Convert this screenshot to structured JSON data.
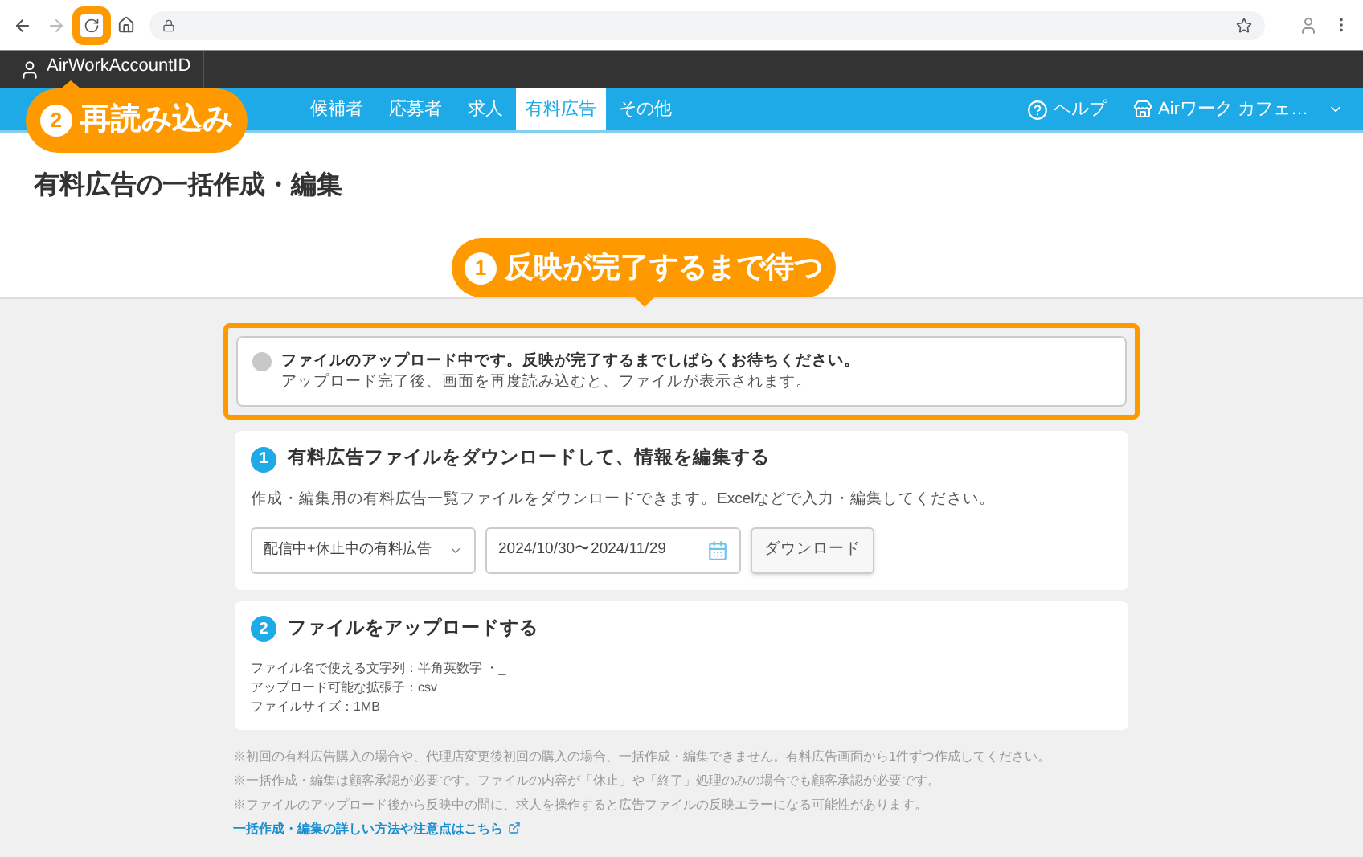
{
  "account": {
    "label": "AirWorkAccountID"
  },
  "nav": {
    "tabs": [
      {
        "label": "候補者",
        "selected": false
      },
      {
        "label": "応募者",
        "selected": false
      },
      {
        "label": "求人",
        "selected": false
      },
      {
        "label": "有料広告",
        "selected": true
      },
      {
        "label": "その他",
        "selected": false
      }
    ],
    "help": "ヘルプ",
    "store": "Airワーク カフェ…"
  },
  "page": {
    "title": "有料広告の一括作成・編集"
  },
  "alert": {
    "title": "ファイルのアップロード中です。反映が完了するまでしばらくお待ちください。",
    "body": "アップロード完了後、画面を再度読み込むと、ファイルが表示されます。"
  },
  "step1": {
    "number": "1",
    "title": "有料広告ファイルをダウンロードして、情報を編集する",
    "description": "作成・編集用の有料広告一覧ファイルをダウンロードできます。Excelなどで入力・編集してください。",
    "select": "配信中+休止中の有料広告",
    "date_range": "2024/10/30〜2024/11/29",
    "button": "ダウンロード"
  },
  "step2": {
    "number": "2",
    "title": "ファイルをアップロードする",
    "lines": [
      "ファイル名で使える文字列：半角英数字 ・_",
      "アップロード可能な拡張子：csv",
      "ファイルサイズ：1MB"
    ]
  },
  "notes": [
    "※初回の有料広告購入の場合や、代理店変更後初回の購入の場合、一括作成・編集できません。有料広告画面から1件ずつ作成してください。",
    "※一括作成・編集は顧客承認が必要です。ファイルの内容が「休止」や「終了」処理のみの場合でも顧客承認が必要です。",
    "※ファイルのアップロード後から反映中の間に、求人を操作すると広告ファイルの反映エラーになる可能性があります。"
  ],
  "help_link": "一括作成・編集の詳しい方法や注意点はこちら",
  "callouts": [
    {
      "number": "1",
      "text": "反映が完了するまで待つ"
    },
    {
      "number": "2",
      "text": "再読み込み"
    }
  ]
}
